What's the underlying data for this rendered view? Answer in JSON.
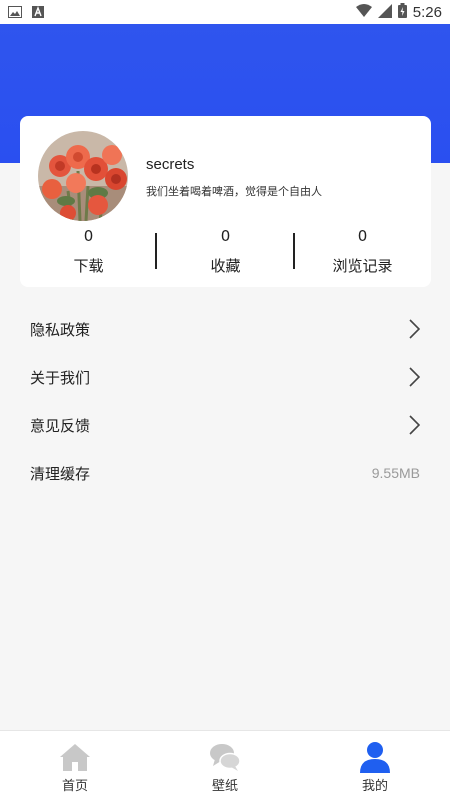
{
  "status_bar": {
    "time": "5:26"
  },
  "profile": {
    "username": "secrets",
    "bio": "我们坐着喝着啤酒，觉得是个自由人",
    "stats": [
      {
        "count": "0",
        "label": "下载"
      },
      {
        "count": "0",
        "label": "收藏"
      },
      {
        "count": "0",
        "label": "浏览记录"
      }
    ]
  },
  "menu": {
    "items": [
      {
        "label": "隐私政策",
        "icon": "chevron-right-icon"
      },
      {
        "label": "关于我们",
        "icon": "chevron-right-icon"
      },
      {
        "label": "意见反馈",
        "icon": "chevron-right-icon"
      },
      {
        "label": "清理缓存",
        "value": "9.55MB"
      }
    ]
  },
  "bottom_nav": {
    "items": [
      {
        "label": "首页",
        "icon": "home-icon"
      },
      {
        "label": "壁纸",
        "icon": "chat-bubbles-icon"
      },
      {
        "label": "我的",
        "icon": "user-icon",
        "active": true
      }
    ]
  },
  "colors": {
    "header_blue": "#2f55ee",
    "active_blue": "#1f5ff0",
    "inactive_gray": "#c8c8c8"
  }
}
